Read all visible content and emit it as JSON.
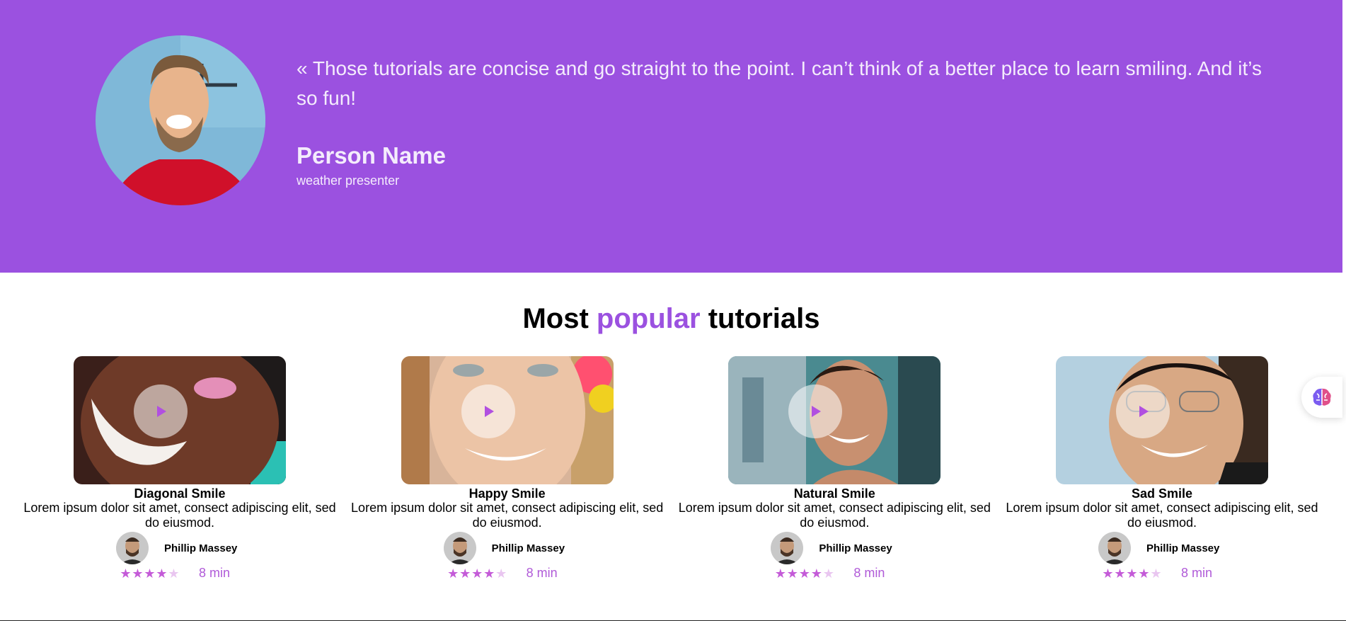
{
  "testimonial": {
    "quote": "« Those tutorials are concise and go straight to the point. I can’t think of a better place to learn smiling. And it’s so fun!",
    "name": "Person Name",
    "role": "weather presenter"
  },
  "section": {
    "title_before": "Most",
    "title_accent": "popular",
    "title_after": "tutorials"
  },
  "cards": [
    {
      "title": "Diagonal Smile",
      "description": "Lorem ipsum dolor sit amet, consect adipiscing elit, sed do eiusmod.",
      "author": "Phillip Massey",
      "rating": 4,
      "rating_max": 5,
      "duration": "8 min"
    },
    {
      "title": "Happy Smile",
      "description": "Lorem ipsum dolor sit amet, consect adipiscing elit, sed do eiusmod.",
      "author": "Phillip Massey",
      "rating": 4,
      "rating_max": 5,
      "duration": "8 min"
    },
    {
      "title": "Natural Smile",
      "description": "Lorem ipsum dolor sit amet, consect adipiscing elit, sed do eiusmod.",
      "author": "Phillip Massey",
      "rating": 4,
      "rating_max": 5,
      "duration": "8 min"
    },
    {
      "title": "Sad Smile",
      "description": "Lorem ipsum dolor sit amet, consect adipiscing elit, sed do eiusmod.",
      "author": "Phillip Massey",
      "rating": 4,
      "rating_max": 5,
      "duration": "8 min"
    }
  ],
  "colors": {
    "hero_bg": "#9b51e0",
    "accent": "#9b51e0",
    "star": "#c45bd8",
    "star_off": "#e9c6f0"
  },
  "icons": {
    "play": "play-icon",
    "star": "star-icon",
    "badge": "brain-icon"
  }
}
